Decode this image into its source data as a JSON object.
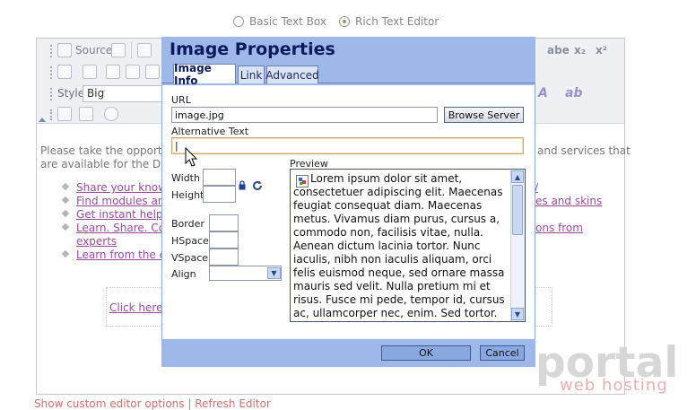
{
  "mode_selector": {
    "options": [
      {
        "label": "Basic Text Box",
        "selected": false
      },
      {
        "label": "Rich Text Editor",
        "selected": true
      }
    ]
  },
  "toolbar": {
    "source_label": "Source",
    "style_label": "Style",
    "style_value": "Big",
    "strike_label": "abe",
    "subscript_label": "x₂",
    "superscript_label": "x²",
    "font_color_label": "A",
    "bg_color_label": "ab"
  },
  "content": {
    "intro_left_1": "Please take the opportur",
    "intro_right_1": "and services that",
    "intro_left_2": "are available for the DotN",
    "links": [
      {
        "left": "Share your knowl",
        "right": "/"
      },
      {
        "left": "Find modules an",
        "right": "es and skins"
      },
      {
        "left": "Get instant help!",
        "right": ""
      },
      {
        "left": "Learn. Share. Co",
        "right": "ons from"
      },
      {
        "left": "experts",
        "right": ""
      },
      {
        "left": "Learn from the ex",
        "right": ""
      }
    ],
    "click_here": "Click here",
    "bottom_links": "Show custom editor options | Refresh Editor"
  },
  "dialog": {
    "title": "Image Properties",
    "tabs": [
      {
        "label": "Image Info",
        "active": true
      },
      {
        "label": "Link",
        "active": false
      },
      {
        "label": "Advanced",
        "active": false
      }
    ],
    "url_label": "URL",
    "url_value": "image.jpg",
    "browse_button": "Browse Server",
    "alt_label": "Alternative Text",
    "alt_value": "|",
    "width_label": "Width",
    "height_label": "Height",
    "border_label": "Border",
    "hspace_label": "HSpace",
    "vspace_label": "VSpace",
    "align_label": "Align",
    "preview_label": "Preview",
    "preview_text": "Lorem ipsum dolor sit amet, consectetuer adipiscing elit. Maecenas feugiat consequat diam. Maecenas metus. Vivamus diam purus, cursus a, commodo non, facilisis vitae, nulla. Aenean dictum lacinia tortor. Nunc iaculis, nibh non iaculis aliquam, orci felis euismod neque, sed ornare massa mauris sed velit. Nulla pretium mi et risus. Fusce mi pede, tempor id, cursus ac, ullamcorper nec, enim. Sed tortor. Curabitur molestie. Duis",
    "ok_button": "OK",
    "cancel_button": "Cancel"
  },
  "logo": {
    "brand": "portal",
    "sub": "web hosting"
  }
}
